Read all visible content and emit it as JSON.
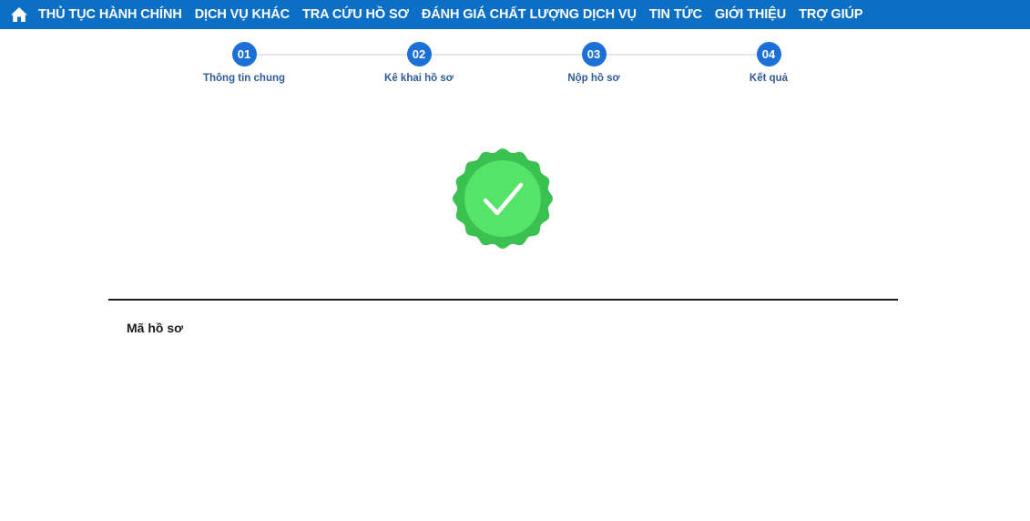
{
  "nav": {
    "items": [
      {
        "label": "THỦ TỤC HÀNH CHÍNH"
      },
      {
        "label": "DỊCH VỤ KHÁC"
      },
      {
        "label": "TRA CỨU HỒ SƠ"
      },
      {
        "label": "ĐÁNH GIÁ CHẤT LƯỢNG DỊCH VỤ"
      },
      {
        "label": "TIN TỨC"
      },
      {
        "label": "GIỚI THIỆU"
      },
      {
        "label": "TRỢ GIÚP"
      }
    ],
    "icon": "home-icon"
  },
  "stepper": {
    "steps": [
      {
        "number": "01",
        "label": "Thông tin chung"
      },
      {
        "number": "02",
        "label": "Kê khai hồ sơ"
      },
      {
        "number": "03",
        "label": "Nộp hồ sơ"
      },
      {
        "number": "04",
        "label": "Kết quả"
      }
    ]
  },
  "result": {
    "icon": "success-check-badge-icon",
    "record_label": "Mã hồ sơ"
  },
  "colors": {
    "nav_bg": "#0b6fc6",
    "step_active": "#1c6fd6",
    "success_outer": "#3ac152",
    "success_inner": "#55e36a"
  }
}
